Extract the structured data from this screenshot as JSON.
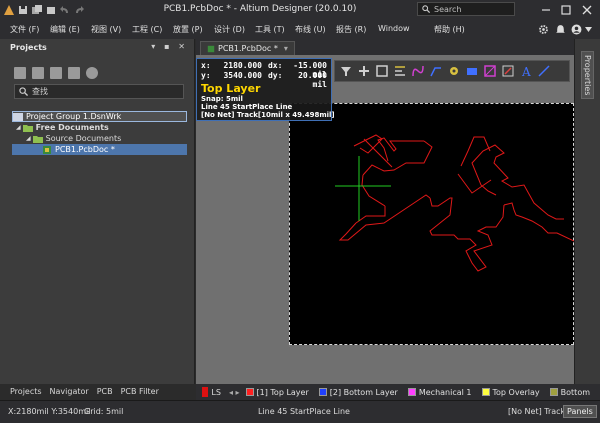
{
  "window": {
    "title": "PCB1.PcbDoc * - Altium Designer (20.0.10)"
  },
  "search": {
    "placeholder": "Search"
  },
  "menu": [
    "文件 (F)",
    "编辑 (E)",
    "视图 (V)",
    "工程 (C)",
    "放置 (P)",
    "设计 (D)",
    "工具 (T)",
    "布线 (U)",
    "报告 (R)",
    "Window",
    "帮助 (H)"
  ],
  "left_panel": {
    "title": "Projects",
    "search_text": "查找",
    "tree": [
      {
        "label": "Project Group 1.DsnWrk",
        "level": 0
      },
      {
        "label": "Free Documents",
        "level": 1
      },
      {
        "label": "Source Documents",
        "level": 2
      },
      {
        "label": "PCB1.PcbDoc *",
        "level": 3
      }
    ],
    "bottom_tabs": [
      "Projects",
      "Navigator",
      "PCB",
      "PCB Filter"
    ]
  },
  "document_tab": {
    "label": "PCB1.PcbDoc *"
  },
  "properties_tab": {
    "label": "Properties"
  },
  "hud": {
    "x_label": "x:",
    "x_value": "2180.000",
    "dx_label": "dx:",
    "dx_value": "-15.000 mil",
    "y_label": "y:",
    "y_value": "3540.000",
    "dy_label": "dy:",
    "dy_value": "20.000 mil",
    "layer": "Top Layer",
    "snap": "Snap: 5mil",
    "action": "Line 45 StartPlace Line",
    "net": "[No Net] Track[10mil x 49.498mil]"
  },
  "layer_bar": {
    "ls_label": "LS",
    "layers": [
      {
        "label": "[1] Top Layer",
        "color": "#ff2020"
      },
      {
        "label": "[2] Bottom Layer",
        "color": "#2040ff"
      },
      {
        "label": "Mechanical 1",
        "color": "#ff40ff"
      },
      {
        "label": "Top Overlay",
        "color": "#ffff40"
      },
      {
        "label": "Bottom",
        "color": "#a0a040"
      }
    ]
  },
  "status": {
    "coords": "X:2180mil Y:3540mil",
    "grid": "Grid: 5mil",
    "message": "Line 45 StartPlace Line",
    "net": "[No Net] Track[1",
    "panels": "Panels"
  },
  "colors": {
    "trace": "#e01818",
    "cursor": "#22cc22",
    "board": "#000000",
    "canvas": "#707070"
  }
}
